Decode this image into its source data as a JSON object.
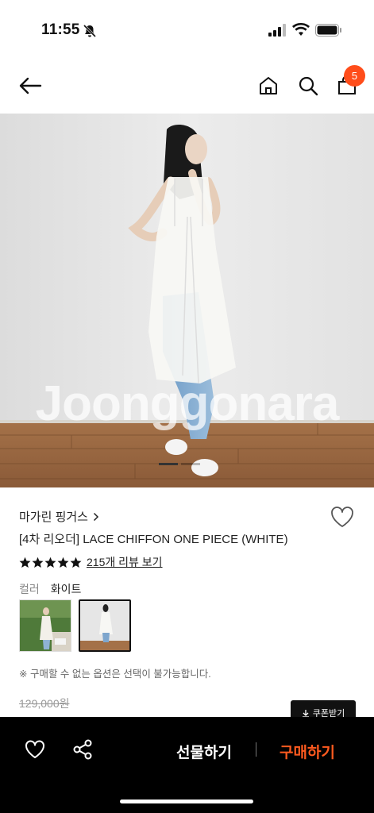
{
  "status_bar": {
    "time": "11:55",
    "icons": [
      "bell-off-icon",
      "signal-icon",
      "wifi-icon",
      "battery-icon"
    ]
  },
  "nav": {
    "cart_count": "5",
    "icons": [
      "back-arrow-icon",
      "home-icon",
      "search-icon",
      "cart-icon"
    ]
  },
  "hero": {
    "watermark": "Joonggonara",
    "slide_index": 1,
    "slide_count": 2
  },
  "product": {
    "brand": "마가린 핑거스",
    "name": "[4차 리오더] LACE CHIFFON ONE PIECE (WHITE)",
    "rating_stars": 5,
    "review_link": "215개 리뷰 보기",
    "color_label": "컬러",
    "color_value": "화이트",
    "notice": "※ 구매할 수 없는 옵션은 선택이 불가능합니다.",
    "original_price": "129,000원",
    "coupon_label": "쿠폰받기"
  },
  "bottom_bar": {
    "gift_label": "선물하기",
    "buy_label": "구매하기"
  },
  "colors": {
    "accent": "#ff4d1a",
    "buy": "#ff5a1f",
    "bar": "#000000"
  }
}
